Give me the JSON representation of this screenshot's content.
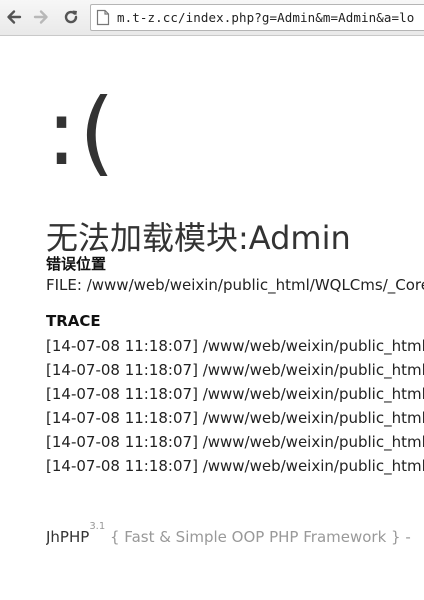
{
  "browser": {
    "url": "m.t-z.cc/index.php?g=Admin&m=Admin&a=lo"
  },
  "page": {
    "face": ":(",
    "title": "无法加载模块:Admin",
    "error_location_label": "错误位置",
    "file_line": "FILE: /www/web/weixin/public_html/WQLCms/_Core/",
    "trace_label": "TRACE",
    "trace": [
      "[14-07-08 11:18:07] /www/web/weixin/public_html",
      "[14-07-08 11:18:07] /www/web/weixin/public_html",
      "[14-07-08 11:18:07] /www/web/weixin/public_html",
      "[14-07-08 11:18:07] /www/web/weixin/public_html",
      "[14-07-08 11:18:07] /www/web/weixin/public_html",
      "[14-07-08 11:18:07] /www/web/weixin/public_html"
    ]
  },
  "footer": {
    "brand": "JhPHP",
    "version": "3.1",
    "tagline": "{ Fast & Simple OOP PHP Framework } -"
  }
}
